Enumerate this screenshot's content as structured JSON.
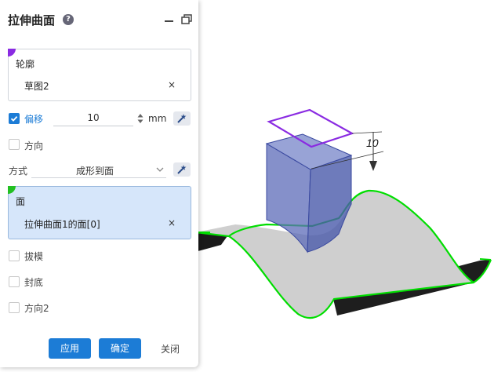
{
  "panel": {
    "title": "拉伸曲面",
    "help_glyph": "?",
    "minimize_icon": "minimize-icon",
    "restore_icon": "restore-window-icon"
  },
  "profile": {
    "label": "轮廓",
    "value": "草图2",
    "clear_glyph": "×",
    "corner_color": "#8a2be2"
  },
  "offset": {
    "checked": true,
    "label": "偏移",
    "value": "10",
    "unit": "mm"
  },
  "direction": {
    "checked": false,
    "label": "方向"
  },
  "mode": {
    "label": "方式",
    "selected": "成形到面"
  },
  "face": {
    "label": "面",
    "value": "拉伸曲面1的面[0]",
    "clear_glyph": "×",
    "corner_color": "#22c022"
  },
  "options": {
    "draft": "拔模",
    "cap": "封底",
    "direction2": "方向2"
  },
  "buttons": {
    "apply": "应用",
    "ok": "确定",
    "close": "关闭"
  },
  "viewport": {
    "dimension_label": "10",
    "sketch_color": "#8a2be2",
    "edge_color": "#00dd00",
    "solid_color": "#5c6bb8"
  },
  "colors": {
    "accent": "#1c7cd6",
    "selected_bg": "#d6e6fa"
  }
}
